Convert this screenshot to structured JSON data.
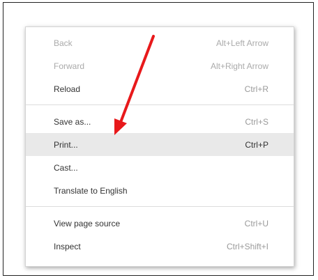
{
  "menu": {
    "items": [
      {
        "label": "Back",
        "shortcut": "Alt+Left Arrow"
      },
      {
        "label": "Forward",
        "shortcut": "Alt+Right Arrow"
      },
      {
        "label": "Reload",
        "shortcut": "Ctrl+R"
      },
      {
        "label": "Save as...",
        "shortcut": "Ctrl+S"
      },
      {
        "label": "Print...",
        "shortcut": "Ctrl+P"
      },
      {
        "label": "Cast...",
        "shortcut": ""
      },
      {
        "label": "Translate to English",
        "shortcut": ""
      },
      {
        "label": "View page source",
        "shortcut": "Ctrl+U"
      },
      {
        "label": "Inspect",
        "shortcut": "Ctrl+Shift+I"
      }
    ],
    "highlighted_item": "Print..."
  },
  "annotation": {
    "arrow_color": "#e8191b"
  },
  "colors": {
    "highlight_bg": "#e9e9e9",
    "text": "#333333",
    "shortcut_text": "#9a9a9a"
  }
}
